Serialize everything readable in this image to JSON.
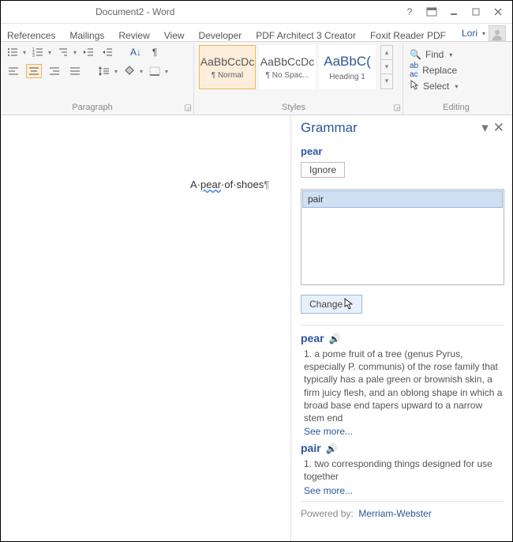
{
  "title": "Document2 - Word",
  "tabs": [
    "References",
    "Mailings",
    "Review",
    "View",
    "Developer",
    "PDF Architect 3 Creator",
    "Foxit Reader PDF"
  ],
  "user": {
    "name": "Lori"
  },
  "ribbon": {
    "paragraph_label": "Paragraph",
    "styles_label": "Styles",
    "editing_label": "Editing",
    "styles": [
      {
        "sample": "AaBbCcDc",
        "name": "¶ Normal"
      },
      {
        "sample": "AaBbCcDc",
        "name": "¶ No Spac..."
      },
      {
        "sample": "AaBbC(",
        "name": "Heading 1"
      }
    ],
    "editing": {
      "find": "Find",
      "replace": "Replace",
      "select": "Select"
    }
  },
  "document": {
    "line": "A·pear·of·shoes¶",
    "err_word": "pear"
  },
  "panel": {
    "title": "Grammar",
    "word": "pear",
    "ignore": "Ignore",
    "suggestion": "pair",
    "change": "Change",
    "defs": [
      {
        "word": "pear",
        "text": "1. a pome fruit of a tree (genus Pyrus, especially P. communis) of the rose family that typically has a pale green or brownish skin, a firm juicy flesh, and an oblong shape in which a broad base end tapers upward to a narrow stem end"
      },
      {
        "word": "pair",
        "text": "1. two corresponding things designed for use together"
      }
    ],
    "seemore": "See more...",
    "powered": "Powered by:",
    "source": "Merriam-Webster"
  }
}
